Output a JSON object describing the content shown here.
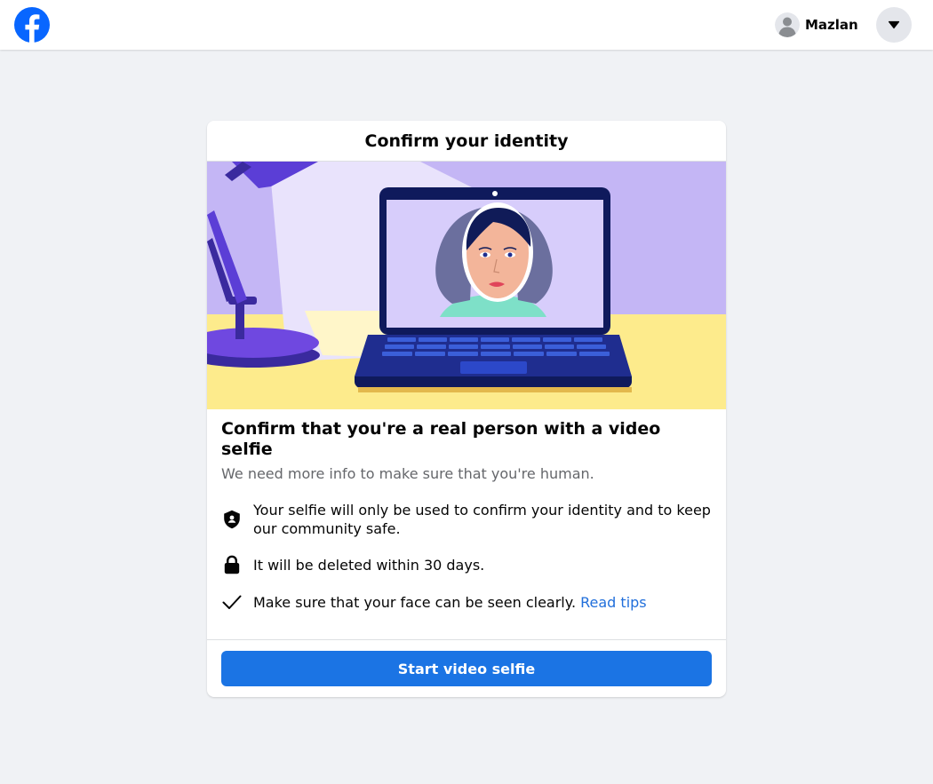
{
  "header": {
    "logo_icon": "facebook-logo-icon",
    "user_name": "Mazlan",
    "menu_icon": "caret-down-icon"
  },
  "card": {
    "title": "Confirm your identity",
    "illustration": "laptop-video-selfie-illustration",
    "headline": "Confirm that you're a real person with a video selfie",
    "subtext": "We need more info to make sure that you're human.",
    "items": [
      {
        "icon": "shield-user-icon",
        "text": "Your selfie will only be used to confirm your identity and to keep our community safe."
      },
      {
        "icon": "lock-icon",
        "text": "It will be deleted within 30 days."
      },
      {
        "icon": "checkmark-icon",
        "text": "Make sure that your face can be seen clearly.",
        "link": "Read tips"
      }
    ],
    "button_label": "Start video selfie"
  },
  "colors": {
    "brand_blue": "#1b74e4",
    "link_blue": "#216fdb",
    "page_bg": "#f0f2f5",
    "secondary_text": "#65676b"
  }
}
